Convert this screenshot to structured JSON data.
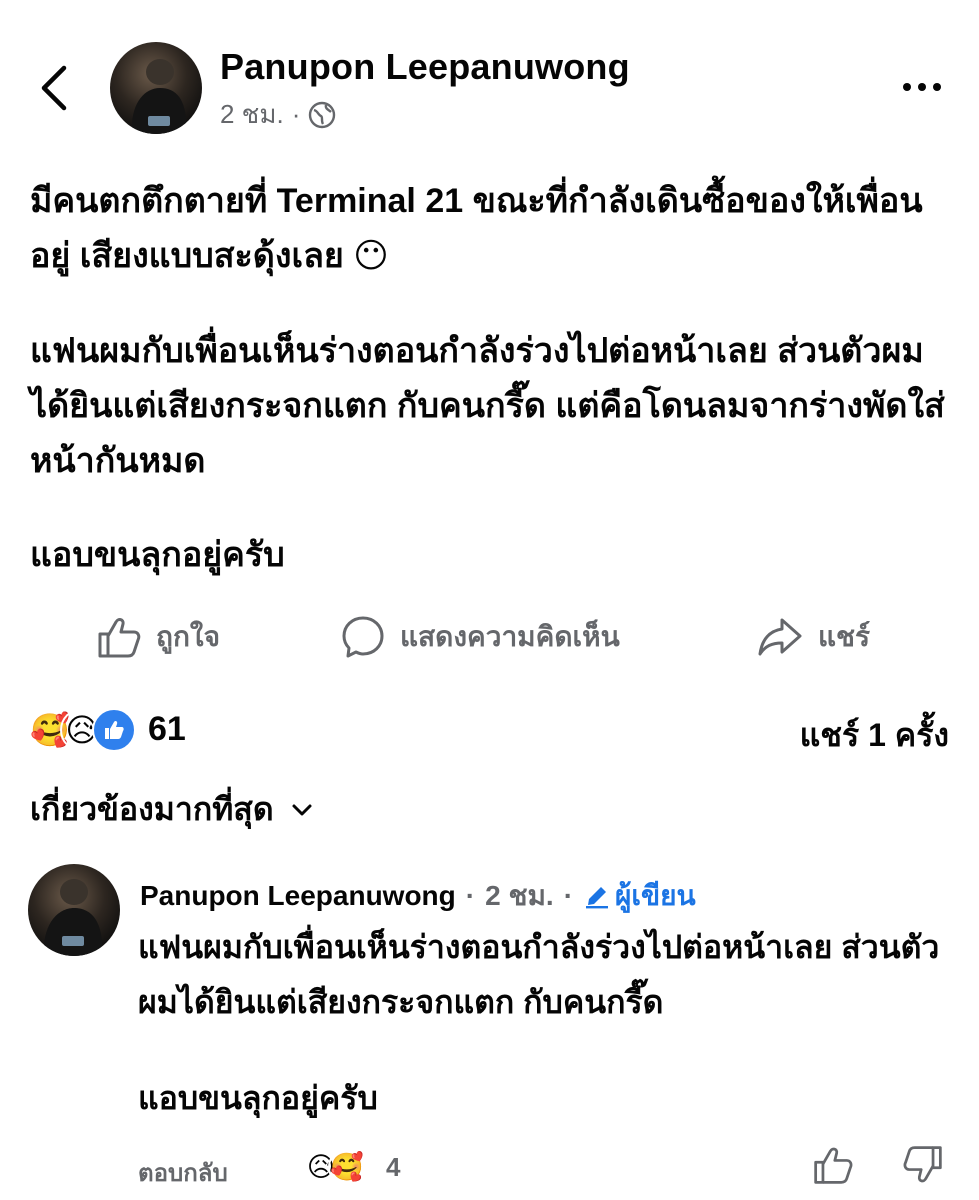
{
  "post": {
    "author": "Panupon Leepanuwong",
    "time": "2 ชม.",
    "separator": "·",
    "paragraphs": [
      "มีคนตกตึกตายที่ Terminal 21 ขณะที่กำลังเดินซื้อของให้เพื่อนอยู่ เสียงแบบสะดุ้งเลย 😶",
      "แฟนผมกับเพื่อนเห็นร่างตอนกำลังร่วงไปต่อหน้าเลย ส่วนตัวผมได้ยินแต่เสียงกระจกแตก กับคนกรี๊ด แต่คือโดนลมจากร่างพัดใส่หน้ากันหมด",
      "แอบขนลุกอยู่ครับ"
    ]
  },
  "actions": {
    "like": "ถูกใจ",
    "comment": "แสดงความคิดเห็น",
    "share": "แชร์"
  },
  "stats": {
    "reactions": [
      "🥰",
      "😥",
      "👍"
    ],
    "reaction_count": "61",
    "shares_label": "แชร์",
    "shares_count": "1",
    "shares_unit": "ครั้ง"
  },
  "sort": {
    "label": "เกี่ยวข้องมากที่สุด"
  },
  "comment": {
    "author": "Panupon Leepanuwong",
    "separator": "·",
    "time": "2 ชม.",
    "badge": "ผู้เขียน",
    "paragraphs": [
      "แฟนผมกับเพื่อนเห็นร่างตอนกำลังร่วงไปต่อหน้าเลย ส่วนตัวผมได้ยินแต่เสียงกระจกแตก กับคนกรี๊ด",
      "แอบขนลุกอยู่ครับ"
    ],
    "reply": "ตอบกลับ",
    "reactions": [
      "😥",
      "🥰"
    ],
    "reaction_count": "4"
  },
  "colors": {
    "text": "#050505",
    "secondary": "#65676b",
    "accent": "#1b74e4",
    "like_blue": "#2f80ed"
  },
  "icons": {
    "back": "chevron-left-icon",
    "more": "more-dots-icon",
    "privacy": "globe-icon",
    "like": "thumbs-up-icon",
    "comment": "speech-bubble-icon",
    "share": "share-arrow-icon",
    "sort": "chevron-down-icon",
    "author_badge": "pencil-icon",
    "comment_like": "thumbs-up-icon",
    "comment_dislike": "thumbs-down-icon"
  }
}
